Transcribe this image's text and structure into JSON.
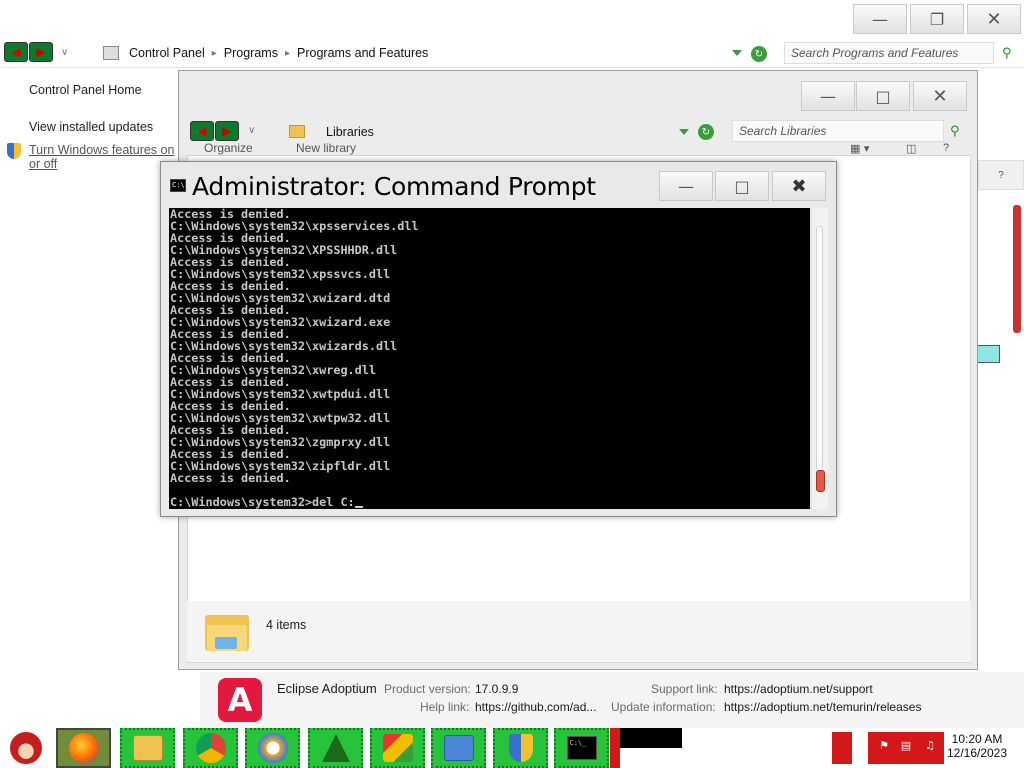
{
  "control_panel": {
    "breadcrumb": [
      "Control Panel",
      "Programs",
      "Programs and Features"
    ],
    "search_placeholder": "Search Programs and Features",
    "sidebar": {
      "home": "Control Panel Home",
      "installed_updates": "View installed updates",
      "features": "Turn Windows features on or off"
    }
  },
  "libraries": {
    "breadcrumb": "Libraries",
    "search_placeholder": "Search Libraries",
    "organize_partial": "Organize",
    "newlib_partial": "New library",
    "items_count": "4 items"
  },
  "details": {
    "publisher": "Eclipse Adoptium",
    "product_version_label": "Product version:",
    "product_version": "17.0.9.9",
    "support_link_label": "Support link:",
    "support_link": "https://adoptium.net/support",
    "help_link_label": "Help link:",
    "help_link": "https://github.com/ad...",
    "update_info_label": "Update information:",
    "update_info": "https://adoptium.net/temurin/releases"
  },
  "cmd": {
    "title": "Administrator: Command Prompt",
    "lines": [
      "Access is denied.",
      "C:\\Windows\\system32\\xpsservices.dll",
      "Access is denied.",
      "C:\\Windows\\system32\\XPSSHHDR.dll",
      "Access is denied.",
      "C:\\Windows\\system32\\xpssvcs.dll",
      "Access is denied.",
      "C:\\Windows\\system32\\xwizard.dtd",
      "Access is denied.",
      "C:\\Windows\\system32\\xwizard.exe",
      "Access is denied.",
      "C:\\Windows\\system32\\xwizards.dll",
      "Access is denied.",
      "C:\\Windows\\system32\\xwreg.dll",
      "Access is denied.",
      "C:\\Windows\\system32\\xwtpdui.dll",
      "Access is denied.",
      "C:\\Windows\\system32\\xwtpw32.dll",
      "Access is denied.",
      "C:\\Windows\\system32\\zgmprxy.dll",
      "Access is denied.",
      "C:\\Windows\\system32\\zipfldr.dll",
      "Access is denied.",
      "",
      "C:\\Windows\\system32>del C:"
    ]
  },
  "taskbar": {
    "clock_time": "10:20 AM",
    "clock_date": "12/16/2023",
    "apps": [
      "firefox-icon",
      "file-explorer-icon",
      "chrome-icon",
      "app-icon",
      "christmas-tree-icon",
      "app-icon",
      "control-panel-icon",
      "shield-icon",
      "cmd-icon"
    ]
  },
  "colors": {
    "taskbar_green": "#27c33a",
    "cmd_background": "#000000",
    "accent_red": "#d21818",
    "adoptium_red": "#e2183e"
  }
}
